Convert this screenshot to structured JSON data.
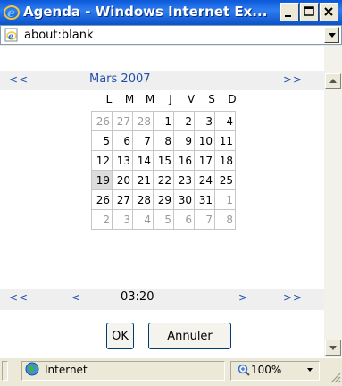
{
  "window": {
    "title": "Agenda - Windows Internet Ex..."
  },
  "address": {
    "value": "about:blank"
  },
  "calendar": {
    "prev_month": "<<",
    "next_month": ">>",
    "month_title": "Mars 2007",
    "weekdays": [
      "L",
      "M",
      "M",
      "J",
      "V",
      "S",
      "D"
    ],
    "weeks": [
      [
        "26",
        "27",
        "28",
        "1",
        "2",
        "3",
        "4"
      ],
      [
        "5",
        "6",
        "7",
        "8",
        "9",
        "10",
        "11"
      ],
      [
        "12",
        "13",
        "14",
        "15",
        "16",
        "17",
        "18"
      ],
      [
        "19",
        "20",
        "21",
        "22",
        "23",
        "24",
        "25"
      ],
      [
        "26",
        "27",
        "28",
        "29",
        "30",
        "31",
        "1"
      ],
      [
        "2",
        "3",
        "4",
        "5",
        "6",
        "7",
        "8"
      ]
    ],
    "selected_day": "19"
  },
  "time": {
    "prev_hour": "<<",
    "prev_minute": "<",
    "value": "03:20",
    "next_minute": ">",
    "next_hour": ">>"
  },
  "buttons": {
    "ok": "OK",
    "cancel": "Annuler"
  },
  "status": {
    "zone": "Internet",
    "zoom": "100%"
  },
  "icons": {
    "title": "ie-icon",
    "address": "ie-page-icon",
    "zone": "globe-icon",
    "zoom": "magnifier-icon"
  }
}
